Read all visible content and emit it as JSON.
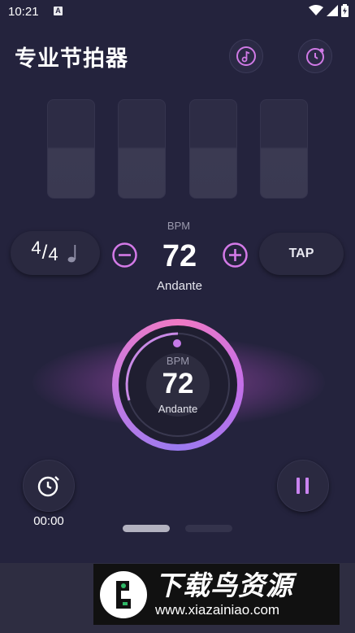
{
  "status_bar": {
    "time": "10:21",
    "a_icon": "A"
  },
  "header": {
    "title": "专业节拍器",
    "sound_icon": "music-note-icon",
    "timer_icon": "clock-icon"
  },
  "beats": [
    {
      "accent": false
    },
    {
      "accent": false
    },
    {
      "accent": false
    },
    {
      "accent": false
    }
  ],
  "controls": {
    "time_signature_top": "4",
    "time_signature_bottom": "4",
    "note_icon": "quarter-note-icon",
    "bpm_label": "BPM",
    "bpm": "72",
    "tempo_name": "Andante",
    "tap_label": "TAP"
  },
  "dial": {
    "bpm_label": "BPM",
    "bpm": "72",
    "tempo_name": "Andante"
  },
  "bottom": {
    "timer_value": "00:00",
    "pause_icon": "pause-icon",
    "timer_icon": "stopwatch-icon"
  },
  "pager": {
    "count": 2,
    "active": 0
  },
  "watermark": {
    "title": "下载鸟资源",
    "url": "www.xiazainiao.com"
  },
  "colors": {
    "background": "#24233d",
    "accent": "#d47ae8",
    "pink": "#f07ac4"
  }
}
